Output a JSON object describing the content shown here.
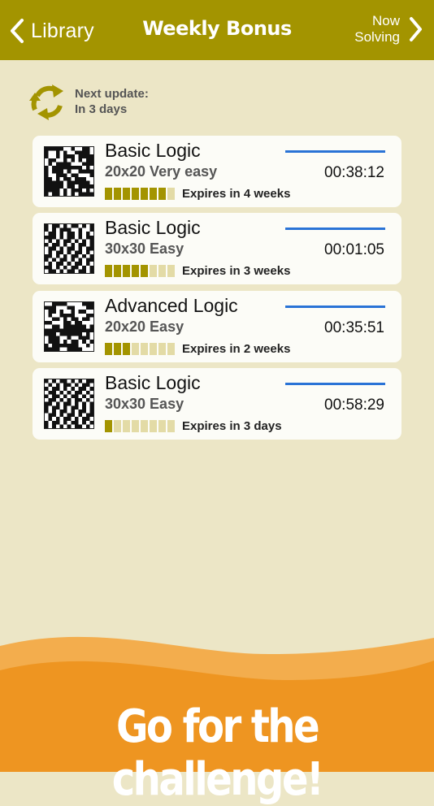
{
  "nav": {
    "back_label": "Library",
    "title": "Weekly Bonus",
    "now_line1": "Now",
    "now_line2": "Solving"
  },
  "update": {
    "line1": "Next update:",
    "line2": "In 3 days"
  },
  "cards": [
    {
      "title": "Basic Logic",
      "subtitle": "20x20 Very easy",
      "time": "00:38:12",
      "expires": "Expires in 4 weeks",
      "remaining_segments": 7,
      "total_segments": 8,
      "thumbnail_icon": "puzzle-thumbnail-icon"
    },
    {
      "title": "Basic Logic",
      "subtitle": "30x30 Easy",
      "time": "00:01:05",
      "expires": "Expires in 3 weeks",
      "remaining_segments": 5,
      "total_segments": 8,
      "thumbnail_icon": "puzzle-thumbnail-icon"
    },
    {
      "title": "Advanced Logic",
      "subtitle": "20x20 Easy",
      "time": "00:35:51",
      "expires": "Expires in 2 weeks",
      "remaining_segments": 3,
      "total_segments": 8,
      "thumbnail_icon": "puzzle-thumbnail-icon"
    },
    {
      "title": "Basic Logic",
      "subtitle": "30x30 Easy",
      "time": "00:58:29",
      "expires": "Expires in 3 days",
      "remaining_segments": 1,
      "total_segments": 8,
      "thumbnail_icon": "puzzle-thumbnail-icon"
    }
  ],
  "promo": "Go for the challenge!",
  "colors": {
    "nav_bar": "#a39400",
    "background": "#ece6c6",
    "accent_blue": "#2a73d6",
    "segment_filled": "#a39400",
    "segment_empty": "#e3dba6",
    "wave_light": "#f3ad4d",
    "wave_dark": "#ee9521"
  }
}
